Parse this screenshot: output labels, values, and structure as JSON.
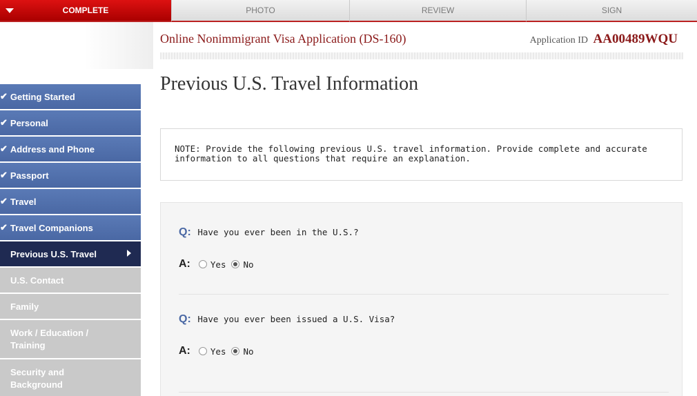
{
  "tabs": {
    "complete": "COMPLETE",
    "photo": "PHOTO",
    "review": "REVIEW",
    "sign": "SIGN"
  },
  "header": {
    "app_title": "Online Nonimmigrant Visa Application (DS-160)",
    "app_id_label": "Application ID",
    "app_id_value": "AA00489WQU"
  },
  "page": {
    "title": "Previous U.S. Travel Information"
  },
  "sidebar": {
    "items": [
      {
        "label": "Getting Started",
        "state": "done"
      },
      {
        "label": "Personal",
        "state": "done"
      },
      {
        "label": "Address and Phone",
        "state": "done"
      },
      {
        "label": "Passport",
        "state": "done"
      },
      {
        "label": "Travel",
        "state": "done"
      },
      {
        "label": "Travel Companions",
        "state": "done"
      },
      {
        "label": "Previous U.S. Travel",
        "state": "current"
      },
      {
        "label": "U.S. Contact",
        "state": "todo"
      },
      {
        "label": "Family",
        "state": "todo"
      },
      {
        "label": "Work / Education / Training",
        "state": "todo"
      },
      {
        "label": "Security and Background",
        "state": "todo"
      }
    ]
  },
  "note": {
    "text": "NOTE: Provide the following previous U.S. travel information. Provide complete and accurate information to all questions that require an explanation."
  },
  "questions": [
    {
      "q_label": "Q:",
      "text": "Have you ever been in the U.S.?",
      "a_label": "A:",
      "options": [
        "Yes",
        "No"
      ],
      "selected": "No"
    },
    {
      "q_label": "Q:",
      "text": "Have you ever been issued a U.S. Visa?",
      "a_label": "A:",
      "options": [
        "Yes",
        "No"
      ],
      "selected": "No"
    }
  ],
  "colors": {
    "accent_red": "#8b1a1a",
    "nav_done": "#4a68a4",
    "nav_current": "#1f2a52",
    "nav_todo": "#c9c9c9"
  }
}
